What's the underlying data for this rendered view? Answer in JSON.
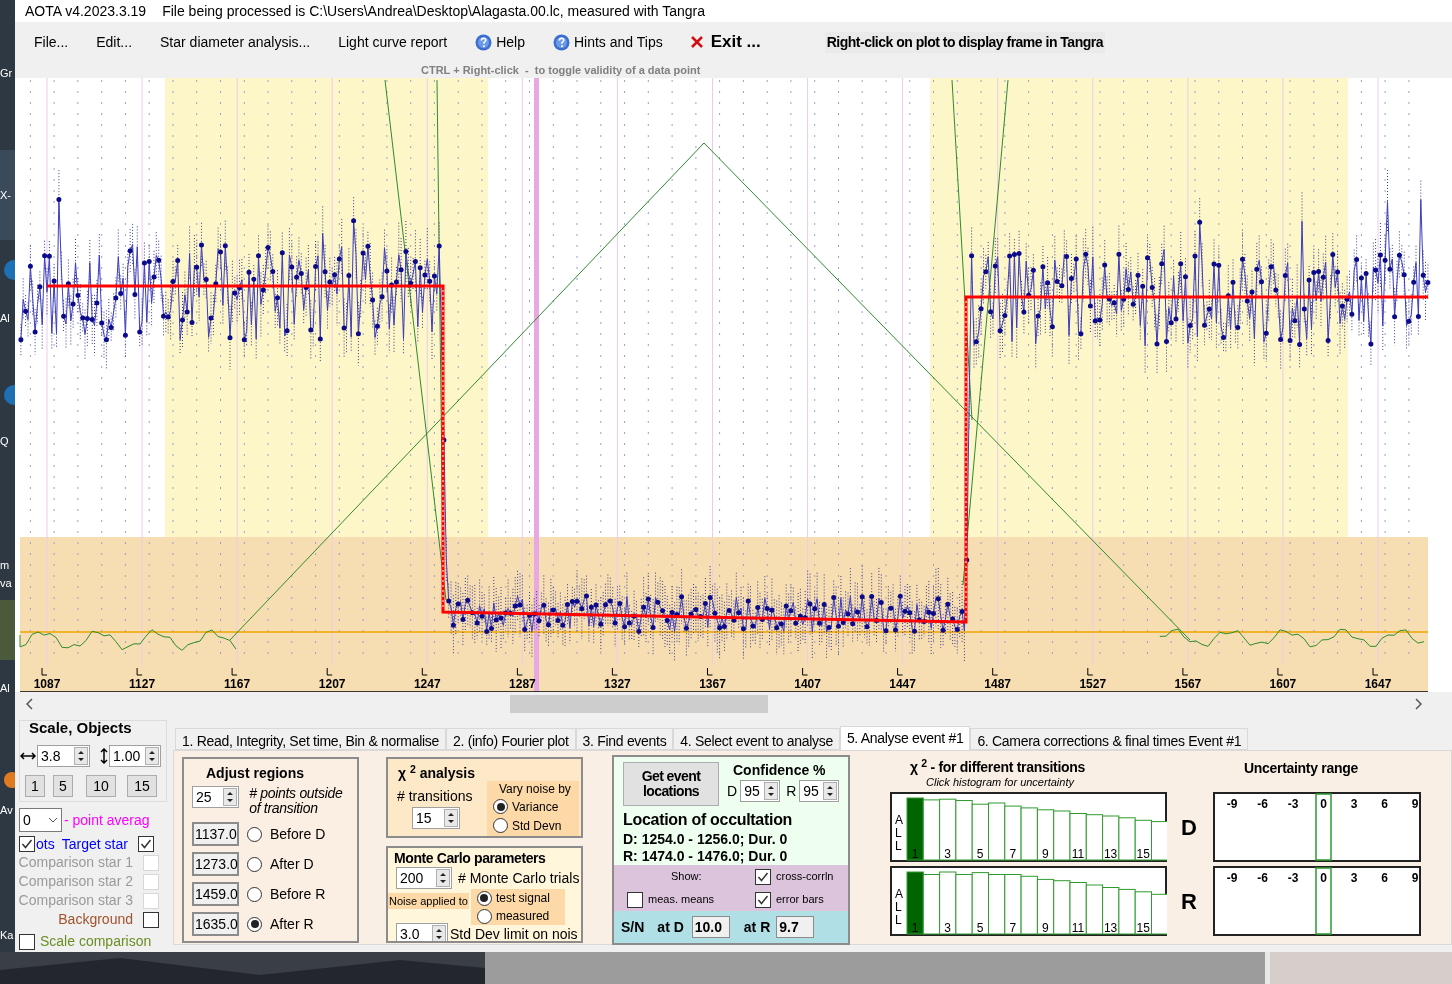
{
  "desktop_labels": [
    "Gr",
    "X-",
    "Al",
    "Q",
    "m",
    "va",
    "Al",
    "Av",
    "Ka"
  ],
  "window": {
    "title": "AOTA v4.2023.3.19",
    "file_info": "File being processed is C:\\Users\\Andrea\\Desktop\\Alagasta.00.lc, measured with Tangra"
  },
  "menu": [
    {
      "label": "File...",
      "kind": "plain"
    },
    {
      "label": "Edit...",
      "kind": "plain"
    },
    {
      "label": "Star diameter analysis...",
      "kind": "plain"
    },
    {
      "label": "Light curve report",
      "kind": "plain"
    },
    {
      "label": "Help",
      "kind": "help"
    },
    {
      "label": "Hints and Tips",
      "kind": "help"
    },
    {
      "label": "Exit ...",
      "kind": "exit"
    }
  ],
  "menu_hint": "Right-click on plot to display frame in Tangra",
  "plot_hint": "CTRL + Right-click  -  to toggle validity of a data point",
  "plot": {
    "x_tick_labels": [
      "1087",
      "1127",
      "1167",
      "1207",
      "1247",
      "1287",
      "1327",
      "1367",
      "1407",
      "1447",
      "1487",
      "1527",
      "1567",
      "1607",
      "1647"
    ]
  },
  "scale_objects": {
    "title": "Scale,  Objects",
    "h_scale": "3.8",
    "v_scale": "1.00",
    "presets": [
      "1",
      "5",
      "10",
      "15"
    ],
    "point_average": "0",
    "point_average_label": "- point averag",
    "plots_toggle": {
      "label": "ots",
      "checked": true
    },
    "objects": [
      {
        "label": "Target star",
        "color": "#0000ff",
        "checked": true,
        "disabled": false
      },
      {
        "label": "Comparison star 1",
        "checked": false,
        "disabled": true
      },
      {
        "label": "Comparison star 2",
        "checked": false,
        "disabled": true
      },
      {
        "label": "Comparison star 3",
        "checked": false,
        "disabled": true
      },
      {
        "label": "Background",
        "color": "#a0522d",
        "checked": false,
        "disabled": false
      }
    ],
    "scale_comparisons": {
      "label": "Scale comparison",
      "checked": false
    }
  },
  "tabs": [
    {
      "label": "1.  Read, Integrity, Set time, Bin & normalise",
      "selected": false
    },
    {
      "label": "2. (info)  Fourier plot",
      "selected": false
    },
    {
      "label": "3. Find events",
      "selected": false
    },
    {
      "label": "4. Select event to analyse",
      "selected": false
    },
    {
      "label": "5. Analyse event #1",
      "selected": true
    },
    {
      "label": "6. Camera corrections & final times Event #1",
      "selected": false
    }
  ],
  "adjust_regions": {
    "title": "Adjust regions",
    "points_outside": "25",
    "points_label": "# points outside of transition",
    "regions": [
      {
        "value": "1137.0",
        "label": "Before D",
        "selected": false
      },
      {
        "value": "1273.0",
        "label": "After D",
        "selected": false
      },
      {
        "value": "1459.0",
        "label": "Before R",
        "selected": false
      },
      {
        "value": "1635.0",
        "label": "After R",
        "selected": true
      }
    ]
  },
  "chi2_analysis": {
    "title": "χ $^{2}$ analysis",
    "transitions_label": "# transitions",
    "transitions": "15",
    "vary_label": "Vary noise by",
    "options": [
      {
        "label": "Variance",
        "selected": true
      },
      {
        "label": "Std Devn",
        "selected": false
      }
    ]
  },
  "monte_carlo": {
    "title": "Monte Carlo parameters",
    "trials": "200",
    "trials_label": "# Monte Carlo trials",
    "noise_label": "Noise applied to",
    "options": [
      {
        "label": "test signal",
        "selected": true
      },
      {
        "label": "measured",
        "selected": false
      }
    ],
    "std_limit": "3.0",
    "std_limit_label": "Std Dev limit on nois"
  },
  "location": {
    "button": "Get event locations",
    "confidence_title": "Confidence %",
    "d_label": "D",
    "d_confidence": "95",
    "r_label": "R",
    "r_confidence": "95",
    "title": "Location of occultation",
    "d_result": "D: 1254.0 - 1256.0; Dur. 0",
    "r_result": "R: 1474.0 - 1476.0; Dur. 0",
    "show_label": "Show:",
    "options": [
      {
        "label": "cross-corrln",
        "checked": true
      },
      {
        "label": "meas. means",
        "checked": false
      },
      {
        "label": "error bars",
        "checked": true
      }
    ],
    "sn_label": "S/N",
    "at_d_label": "at D",
    "sn_d": "10.0",
    "at_r_label": "at R",
    "sn_r": "9.7"
  },
  "transitions": {
    "title": "χ $^{2}$ - for different transitions",
    "subtitle": "Click histogram for uncertainty",
    "panels": [
      {
        "label": "D",
        "side_text": "ALL",
        "bar_labels": [
          "1",
          "3",
          "5",
          "7",
          "9",
          "11",
          "13",
          "15"
        ]
      },
      {
        "label": "R",
        "side_text": "ALL",
        "bar_labels": [
          "1",
          "3",
          "5",
          "7",
          "9",
          "11",
          "13",
          "15"
        ]
      }
    ]
  },
  "uncertainty": {
    "title": "Uncertainty range",
    "panels": [
      {
        "ticks": [
          "-9",
          "-6",
          "-3",
          "0",
          "3",
          "6",
          "9"
        ]
      },
      {
        "ticks": [
          "-9",
          "-6",
          "-3",
          "0",
          "3",
          "6",
          "9"
        ]
      }
    ]
  }
}
